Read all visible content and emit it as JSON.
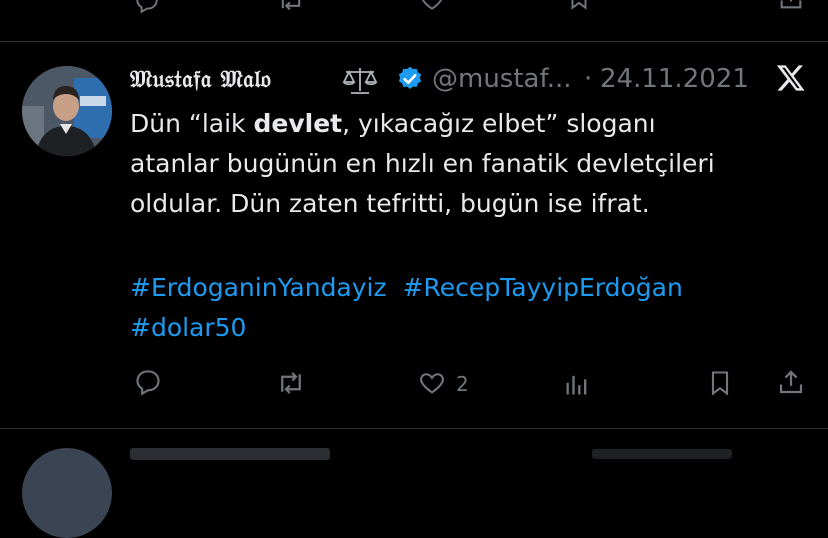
{
  "previous_tweet": {
    "actions": [
      "reply-icon",
      "retweet-icon",
      "like-icon",
      "bookmark-icon",
      "share-icon"
    ]
  },
  "tweet": {
    "author": {
      "display_name": "𝔐𝔲𝔰𝔱𝔞𝔣𝔞 𝔐𝔞𝔩𝔬",
      "name_emoji": "⚖️",
      "verified": true,
      "handle": "@mustaf...",
      "separator": "·",
      "date": "24.11.2021"
    },
    "text": {
      "line1_before": "Dün “laik ",
      "line1_bold": "devlet",
      "line1_after": ", yıkacağız elbet” sloganı",
      "line2": "atanlar bugünün en hızlı en fanatik devletçileri",
      "line3": "oldular. Dün zaten tefritti, bugün ise ifrat."
    },
    "hashtags": [
      "#ErdoganinYandayiz",
      "#RecepTayyipErdoğan",
      "#dolar50"
    ],
    "actions": {
      "reply_count": "",
      "retweet_count": "",
      "like_count": "2",
      "views_count": "",
      "bookmark_icon": "bookmark-icon",
      "share_icon": "share-icon"
    },
    "logo": "x-logo-icon"
  },
  "next_tweet": {
    "partial": true
  },
  "colors": {
    "background": "#000000",
    "text": "#e7e9ea",
    "muted": "#71767b",
    "link": "#1d9bf0",
    "verified": "#1d9bf0",
    "divider": "#2f3336"
  }
}
